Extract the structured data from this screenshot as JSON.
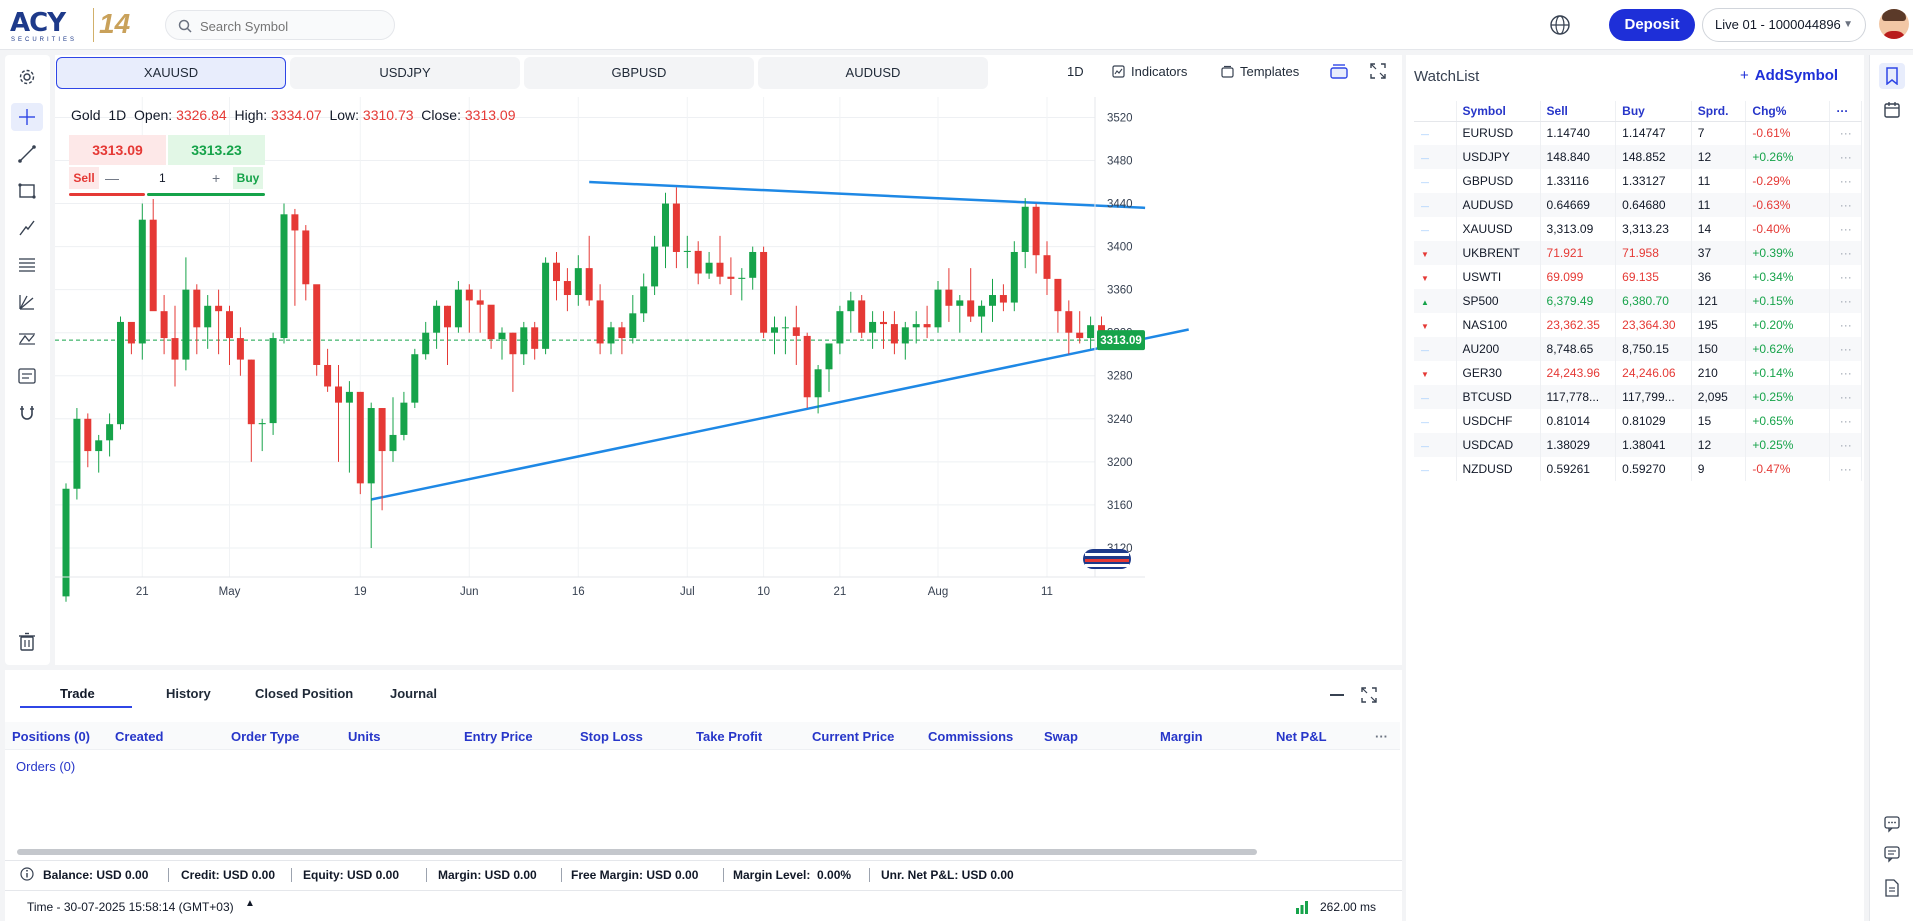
{
  "brand": {
    "name": "ACY",
    "tagline": "SECURITIES",
    "years": "14"
  },
  "search": {
    "placeholder": "Search Symbol"
  },
  "header": {
    "deposit_label": "Deposit",
    "account_label": "Live 01 - 1000044896"
  },
  "symbol_tabs": [
    "XAUUSD",
    "USDJPY",
    "GBPUSD",
    "AUDUSD"
  ],
  "chart_controls": {
    "timeframe": "1D",
    "indicators": "Indicators",
    "templates": "Templates"
  },
  "ohlc": {
    "name": "Gold",
    "tf": "1D",
    "open_label": "Open:",
    "open": "3326.84",
    "high_label": "High:",
    "high": "3334.07",
    "low_label": "Low:",
    "low": "3310.73",
    "close_label": "Close:",
    "close": "3313.09"
  },
  "quote": {
    "sell_price": "3313.09",
    "buy_price": "3313.23",
    "sell_label": "Sell",
    "buy_label": "Buy",
    "qty": "1",
    "minus": "—",
    "plus": "+"
  },
  "chart_data": {
    "type": "candlestick",
    "symbol": "XAUUSD",
    "y_ticks": [
      3520,
      3480,
      3440,
      3400,
      3360,
      3320,
      3280,
      3240,
      3200,
      3160,
      3120
    ],
    "ylim": [
      3093,
      3539
    ],
    "x_ticks": [
      "21",
      "May",
      "19",
      "Jun",
      "16",
      "Jul",
      "10",
      "21",
      "Aug",
      "11"
    ],
    "last_price": "3313.09",
    "candles": [
      [
        3075,
        3180,
        3070,
        3175
      ],
      [
        3175,
        3250,
        3165,
        3240
      ],
      [
        3240,
        3245,
        3195,
        3210
      ],
      [
        3210,
        3225,
        3190,
        3220
      ],
      [
        3220,
        3245,
        3205,
        3235
      ],
      [
        3235,
        3335,
        3230,
        3330
      ],
      [
        3330,
        3320,
        3300,
        3310
      ],
      [
        3310,
        3440,
        3295,
        3425
      ],
      [
        3425,
        3460,
        3400,
        3340
      ],
      [
        3340,
        3355,
        3300,
        3315
      ],
      [
        3315,
        3345,
        3270,
        3295
      ],
      [
        3295,
        3390,
        3285,
        3360
      ],
      [
        3360,
        3365,
        3300,
        3325
      ],
      [
        3325,
        3355,
        3305,
        3345
      ],
      [
        3345,
        3360,
        3300,
        3340
      ],
      [
        3340,
        3345,
        3290,
        3315
      ],
      [
        3315,
        3325,
        3280,
        3295
      ],
      [
        3295,
        3295,
        3200,
        3235
      ],
      [
        3235,
        3240,
        3210,
        3236
      ],
      [
        3236,
        3320,
        3225,
        3315
      ],
      [
        3315,
        3440,
        3310,
        3430
      ],
      [
        3430,
        3435,
        3345,
        3415
      ],
      [
        3415,
        3420,
        3350,
        3365
      ],
      [
        3365,
        3350,
        3280,
        3290
      ],
      [
        3290,
        3305,
        3265,
        3270
      ],
      [
        3270,
        3290,
        3200,
        3255
      ],
      [
        3255,
        3275,
        3190,
        3265
      ],
      [
        3265,
        3265,
        3170,
        3180
      ],
      [
        3180,
        3255,
        3120,
        3250
      ],
      [
        3250,
        3250,
        3155,
        3210
      ],
      [
        3210,
        3260,
        3200,
        3225
      ],
      [
        3225,
        3265,
        3220,
        3255
      ],
      [
        3255,
        3305,
        3250,
        3300
      ],
      [
        3300,
        3330,
        3295,
        3320
      ],
      [
        3320,
        3350,
        3305,
        3345
      ],
      [
        3345,
        3345,
        3290,
        3325
      ],
      [
        3325,
        3368,
        3320,
        3360
      ],
      [
        3360,
        3365,
        3320,
        3350
      ],
      [
        3350,
        3360,
        3320,
        3346
      ],
      [
        3346,
        3340,
        3305,
        3314
      ],
      [
        3314,
        3325,
        3295,
        3320
      ],
      [
        3320,
        3320,
        3265,
        3300
      ],
      [
        3300,
        3330,
        3290,
        3325
      ],
      [
        3325,
        3330,
        3295,
        3305
      ],
      [
        3305,
        3390,
        3300,
        3385
      ],
      [
        3385,
        3395,
        3350,
        3368
      ],
      [
        3368,
        3380,
        3340,
        3355
      ],
      [
        3355,
        3392,
        3345,
        3380
      ],
      [
        3380,
        3410,
        3345,
        3350
      ],
      [
        3350,
        3365,
        3300,
        3310
      ],
      [
        3310,
        3330,
        3300,
        3325
      ],
      [
        3325,
        3330,
        3300,
        3315
      ],
      [
        3315,
        3355,
        3310,
        3338
      ],
      [
        3338,
        3375,
        3330,
        3363
      ],
      [
        3363,
        3410,
        3355,
        3400
      ],
      [
        3400,
        3450,
        3380,
        3440
      ],
      [
        3440,
        3455,
        3380,
        3395
      ],
      [
        3395,
        3410,
        3380,
        3396
      ],
      [
        3396,
        3405,
        3365,
        3375
      ],
      [
        3375,
        3395,
        3370,
        3385
      ],
      [
        3385,
        3410,
        3365,
        3372
      ],
      [
        3372,
        3390,
        3355,
        3370
      ],
      [
        3370,
        3380,
        3350,
        3371
      ],
      [
        3371,
        3400,
        3360,
        3395
      ],
      [
        3395,
        3400,
        3315,
        3320
      ],
      [
        3320,
        3335,
        3300,
        3325
      ],
      [
        3325,
        3335,
        3300,
        3325
      ],
      [
        3325,
        3345,
        3290,
        3317
      ],
      [
        3317,
        3320,
        3250,
        3260
      ],
      [
        3260,
        3290,
        3245,
        3286
      ],
      [
        3286,
        3300,
        3265,
        3310
      ],
      [
        3310,
        3345,
        3300,
        3340
      ],
      [
        3340,
        3358,
        3320,
        3350
      ],
      [
        3350,
        3355,
        3315,
        3320
      ],
      [
        3320,
        3340,
        3305,
        3330
      ],
      [
        3330,
        3340,
        3305,
        3328
      ],
      [
        3328,
        3340,
        3300,
        3310
      ],
      [
        3310,
        3330,
        3295,
        3325
      ],
      [
        3325,
        3340,
        3310,
        3328
      ],
      [
        3328,
        3345,
        3315,
        3325
      ],
      [
        3325,
        3368,
        3320,
        3360
      ],
      [
        3360,
        3380,
        3330,
        3345
      ],
      [
        3345,
        3355,
        3320,
        3350
      ],
      [
        3350,
        3380,
        3330,
        3335
      ],
      [
        3335,
        3350,
        3320,
        3345
      ],
      [
        3345,
        3370,
        3330,
        3355
      ],
      [
        3355,
        3365,
        3340,
        3348
      ],
      [
        3348,
        3405,
        3340,
        3395
      ],
      [
        3395,
        3445,
        3380,
        3437
      ],
      [
        3437,
        3440,
        3375,
        3392
      ],
      [
        3392,
        3405,
        3355,
        3370
      ],
      [
        3370,
        3365,
        3320,
        3340
      ],
      [
        3340,
        3350,
        3300,
        3320
      ],
      [
        3320,
        3340,
        3310,
        3315
      ],
      [
        3315,
        3335,
        3305,
        3327
      ],
      [
        3327,
        3335,
        3305,
        3313
      ]
    ],
    "trendlines": [
      {
        "from": {
          "i": 28,
          "price": 3165
        },
        "to": {
          "i": 103,
          "price": 3323
        }
      },
      {
        "from": {
          "i": 48,
          "price": 3460
        },
        "to": {
          "i": 99,
          "price": 3436
        }
      }
    ]
  },
  "watchlist": {
    "title": "WatchList",
    "add_label": "AddSymbol",
    "headers": [
      "Symbol",
      "Sell",
      "Buy",
      "Sprd.",
      "Chg%"
    ],
    "more": "···",
    "rows": [
      {
        "mark": "flat",
        "symbol": "EURUSD",
        "sell": "1.14740",
        "buy": "1.14747",
        "spread": "7",
        "chg": "-0.61%",
        "dir": "neg",
        "price_color": "none"
      },
      {
        "mark": "flat",
        "symbol": "USDJPY",
        "sell": "148.840",
        "buy": "148.852",
        "spread": "12",
        "chg": "+0.26%",
        "dir": "pos",
        "price_color": "none"
      },
      {
        "mark": "flat",
        "symbol": "GBPUSD",
        "sell": "1.33116",
        "buy": "1.33127",
        "spread": "11",
        "chg": "-0.29%",
        "dir": "neg",
        "price_color": "none"
      },
      {
        "mark": "flat",
        "symbol": "AUDUSD",
        "sell": "0.64669",
        "buy": "0.64680",
        "spread": "11",
        "chg": "-0.63%",
        "dir": "neg",
        "price_color": "none"
      },
      {
        "mark": "flat",
        "symbol": "XAUUSD",
        "sell": "3,313.09",
        "buy": "3,313.23",
        "spread": "14",
        "chg": "-0.40%",
        "dir": "neg",
        "price_color": "none"
      },
      {
        "mark": "down",
        "symbol": "UKBRENT",
        "sell": "71.921",
        "buy": "71.958",
        "spread": "37",
        "chg": "+0.39%",
        "dir": "pos",
        "price_color": "neg"
      },
      {
        "mark": "down",
        "symbol": "USWTI",
        "sell": "69.099",
        "buy": "69.135",
        "spread": "36",
        "chg": "+0.34%",
        "dir": "pos",
        "price_color": "neg"
      },
      {
        "mark": "up",
        "symbol": "SP500",
        "sell": "6,379.49",
        "buy": "6,380.70",
        "spread": "121",
        "chg": "+0.15%",
        "dir": "pos",
        "price_color": "pos"
      },
      {
        "mark": "down",
        "symbol": "NAS100",
        "sell": "23,362.35",
        "buy": "23,364.30",
        "spread": "195",
        "chg": "+0.20%",
        "dir": "pos",
        "price_color": "neg"
      },
      {
        "mark": "flat",
        "symbol": "AU200",
        "sell": "8,748.65",
        "buy": "8,750.15",
        "spread": "150",
        "chg": "+0.62%",
        "dir": "pos",
        "price_color": "none"
      },
      {
        "mark": "down",
        "symbol": "GER30",
        "sell": "24,243.96",
        "buy": "24,246.06",
        "spread": "210",
        "chg": "+0.14%",
        "dir": "pos",
        "price_color": "neg"
      },
      {
        "mark": "flat",
        "symbol": "BTCUSD",
        "sell": "117,778...",
        "buy": "117,799...",
        "spread": "2,095",
        "chg": "+0.25%",
        "dir": "pos",
        "price_color": "none"
      },
      {
        "mark": "flat",
        "symbol": "USDCHF",
        "sell": "0.81014",
        "buy": "0.81029",
        "spread": "15",
        "chg": "+0.65%",
        "dir": "pos",
        "price_color": "none"
      },
      {
        "mark": "flat",
        "symbol": "USDCAD",
        "sell": "1.38029",
        "buy": "1.38041",
        "spread": "12",
        "chg": "+0.25%",
        "dir": "pos",
        "price_color": "none"
      },
      {
        "mark": "flat",
        "symbol": "NZDUSD",
        "sell": "0.59261",
        "buy": "0.59270",
        "spread": "9",
        "chg": "-0.47%",
        "dir": "neg",
        "price_color": "none"
      }
    ]
  },
  "bottom": {
    "tabs": [
      "Trade",
      "History",
      "Closed Position",
      "Journal"
    ],
    "columns": [
      "Positions (0)",
      "Created",
      "Order Type",
      "Units",
      "Entry Price",
      "Stop Loss",
      "Take Profit",
      "Current Price",
      "Commissions",
      "Swap",
      "Margin",
      "Net P&L"
    ],
    "more": "···",
    "orders_label": "Orders (0)",
    "status": [
      "Balance: USD 0.00",
      "Credit: USD 0.00",
      "Equity: USD 0.00",
      "Margin: USD 0.00",
      "Free Margin: USD 0.00",
      "Margin Level:  0.00%",
      "Unr. Net P&L: USD 0.00"
    ],
    "time": "Time - 30-07-2025 15:58:14 (GMT+03)",
    "latency": "262.00 ms"
  },
  "colors": {
    "accent": "#1e2fd8",
    "bull": "#16a34a",
    "bear": "#e53935",
    "trend": "#1e88e5",
    "price_tag": "#16a34a"
  }
}
